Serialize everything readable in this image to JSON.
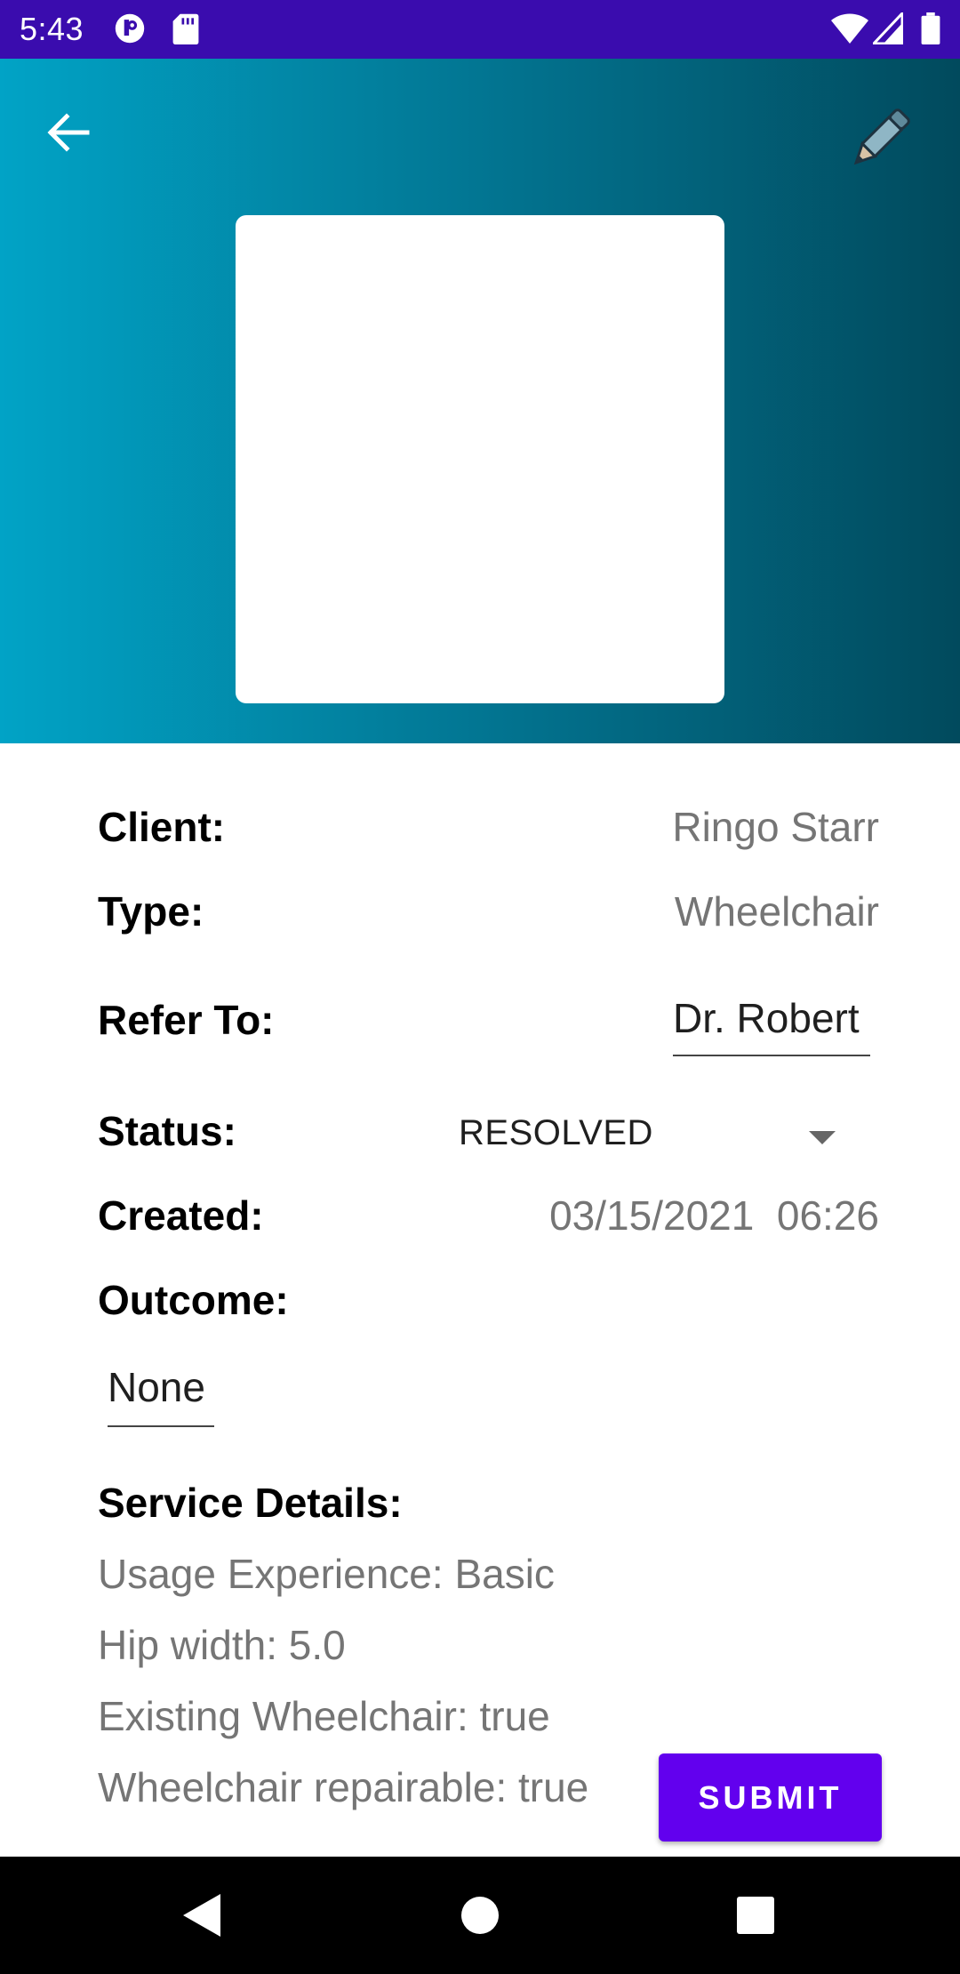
{
  "status_bar": {
    "time": "5:43"
  },
  "icons": {
    "back": "arrow-back-icon",
    "edit": "pencil-icon"
  },
  "details": {
    "client_label": "Client:",
    "client_value": "Ringo Starr",
    "type_label": "Type:",
    "type_value": "Wheelchair",
    "refer_label": "Refer To:",
    "refer_value": "Dr. Robert",
    "status_label": "Status:",
    "status_value": "RESOLVED",
    "created_label": "Created:",
    "created_value": "03/15/2021  06:26",
    "outcome_label": "Outcome:",
    "outcome_value": "None",
    "service_label": "Service Details:",
    "service_lines": [
      "Usage Experience: Basic",
      "Hip width: 5.0",
      "Existing Wheelchair: true",
      "Wheelchair repairable: true"
    ]
  },
  "actions": {
    "submit_label": "SUBMIT"
  },
  "colors": {
    "status_bar": "#3a0cae",
    "accent": "#6200ee",
    "header_start": "#01a3c6",
    "header_end": "#014a5d"
  }
}
